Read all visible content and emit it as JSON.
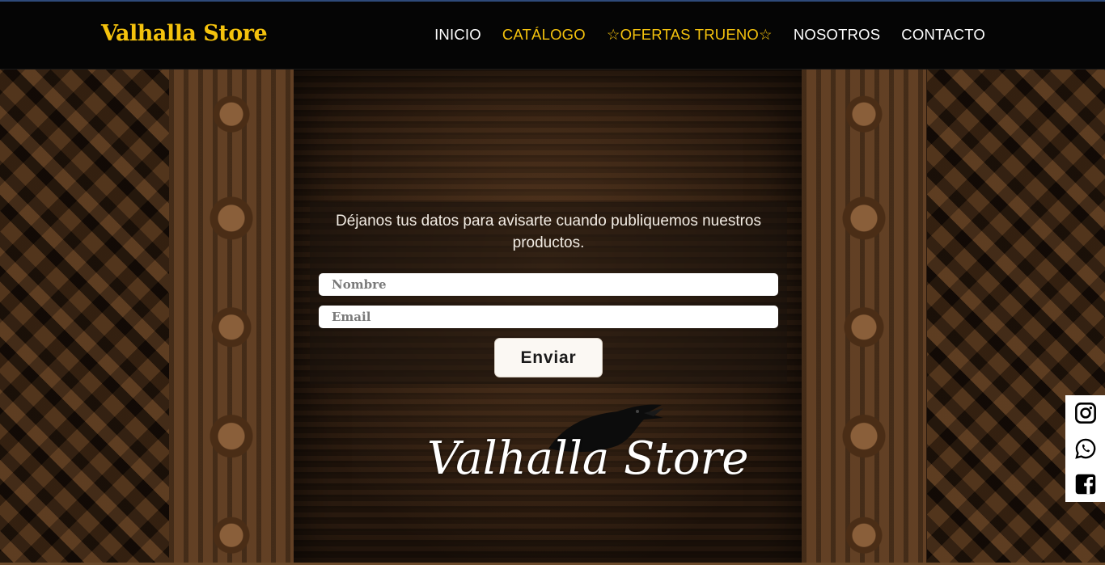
{
  "header": {
    "brand": "Valhalla Store",
    "nav": [
      {
        "label": "INICIO",
        "active": false
      },
      {
        "label": "CATÁLOGO",
        "active": true
      },
      {
        "label": "☆OFERTAS TRUENO☆",
        "active": true
      },
      {
        "label": "NOSOTROS",
        "active": false
      },
      {
        "label": "CONTACTO",
        "active": false
      }
    ]
  },
  "form": {
    "intro": "Déjanos tus datos para avisarte cuando publiquemos nuestros productos.",
    "name_placeholder": "Nombre",
    "email_placeholder": "Email",
    "submit_label": "Enviar"
  },
  "logo": {
    "text": "Valhalla Store"
  },
  "social": [
    {
      "icon": "instagram-icon"
    },
    {
      "icon": "whatsapp-icon"
    },
    {
      "icon": "facebook-icon"
    }
  ],
  "colors": {
    "accent": "#f4c20d",
    "navbar_bg": "#050505",
    "text_light": "#ffffff"
  }
}
